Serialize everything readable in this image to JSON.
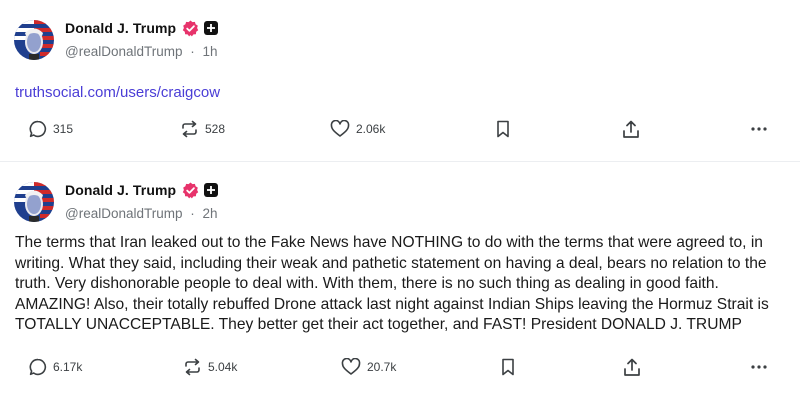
{
  "posts": [
    {
      "author": "Donald J. Trump",
      "handle": "@realDonaldTrump",
      "time": "1h",
      "separator": "·",
      "link": "truthsocial.com/users/craigcow",
      "replies": "315",
      "reposts": "528",
      "likes": "2.06k"
    },
    {
      "author": "Donald J. Trump",
      "handle": "@realDonaldTrump",
      "time": "2h",
      "separator": "·",
      "text": "The terms that Iran leaked out to the Fake News have NOTHING to do with the terms that were agreed to, in writing. What they said, including their weak and pathetic statement on having a deal, bears no relation to the truth. Very dishonorable people to deal with. With them, there is no such thing as dealing in good faith. AMAZING! Also, their totally rebuffed Drone attack last night against Indian Ships leaving the Hormuz Strait is TOTALLY UNACCEPTABLE. They better get their act together, and FAST! President DONALD J. TRUMP",
      "replies": "6.17k",
      "reposts": "5.04k",
      "likes": "20.7k"
    }
  ],
  "icons": {
    "reply": "speech-bubble-icon",
    "repost": "repost-arrows-icon",
    "like": "heart-icon",
    "bookmark": "bookmark-icon",
    "share": "share-upload-icon",
    "more": "more-dots-icon",
    "verified": "verified-badge-icon",
    "plus": "plus-badge-icon"
  },
  "colors": {
    "link": "#4a3dd6",
    "verified": "#e7336b",
    "muted": "#6f7479",
    "divider": "#eceef1"
  }
}
